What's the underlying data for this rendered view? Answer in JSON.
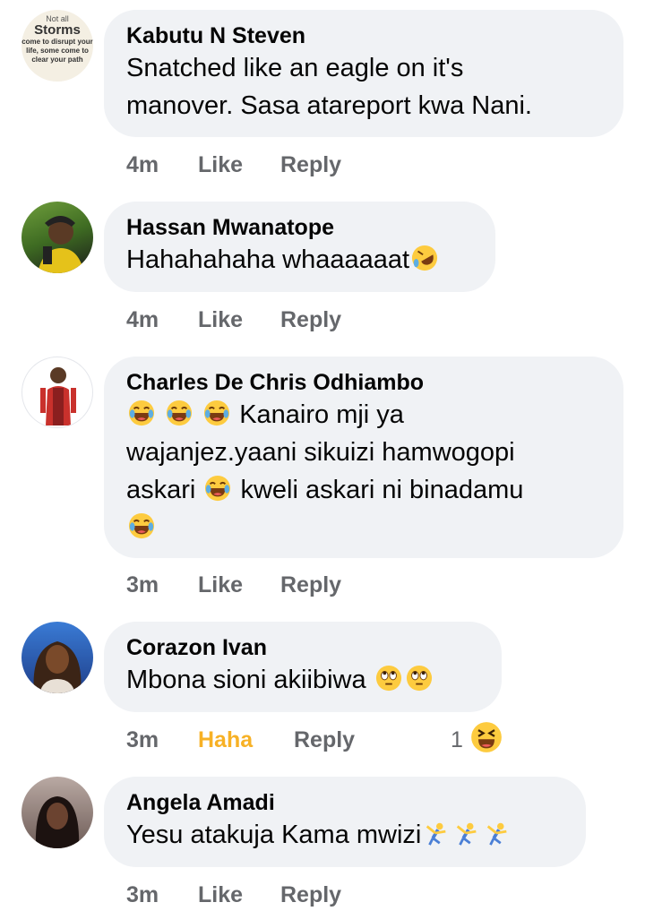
{
  "comments": [
    {
      "author": "Kabutu N Steven",
      "avatar_text": [
        "Not all",
        "Storms",
        "come to disrupt your",
        "life, some come to",
        "clear your path"
      ],
      "line1": "Snatched like an eagle on it's",
      "line2": "manover. Sasa atareport kwa  Nani.",
      "time": "4m",
      "like": "Like",
      "reply": "Reply"
    },
    {
      "author": "Hassan Mwanatope",
      "line1": "Hahahahaha whaaaaaat",
      "time": "4m",
      "like": "Like",
      "reply": "Reply"
    },
    {
      "author": "Charles De Chris Odhiambo",
      "line1": "Kanairo mji ya",
      "line2": "wajanjez.yaani sikuizi hamwogopi",
      "line3a": "askari",
      "line3b": "kweli askari ni binadamu",
      "time": "3m",
      "like": "Like",
      "reply": "Reply"
    },
    {
      "author": "Corazon Ivan",
      "line1": "Mbona sioni akiibiwa",
      "time": "3m",
      "like": "Haha",
      "reply": "Reply",
      "reaction_count": "1"
    },
    {
      "author": "Angela Amadi",
      "line1": "Yesu atakuja Kama mwizi",
      "time": "3m",
      "like": "Like",
      "reply": "Reply"
    }
  ],
  "colors": {
    "bubble": "#f0f2f5",
    "meta": "#65676b",
    "haha": "#f7b125"
  }
}
